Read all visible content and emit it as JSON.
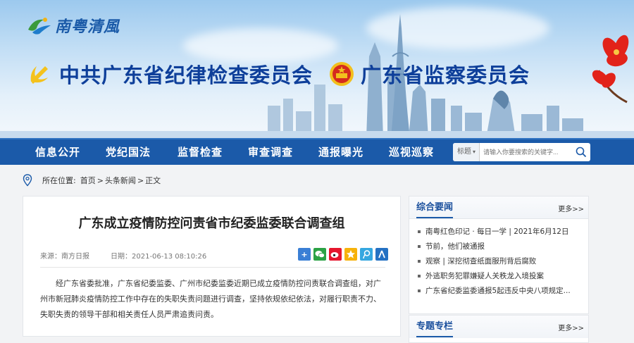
{
  "site": {
    "logo_text": "南粤清風",
    "org_party": "中共广东省纪律检查委员会",
    "org_supervision": "广东省监察委员会"
  },
  "nav": {
    "items": [
      "信息公开",
      "党纪国法",
      "监督检查",
      "审查调查",
      "通报曝光",
      "巡视巡察"
    ],
    "search_select": "标题",
    "search_placeholder": "请输入你要搜索的关键字...",
    "search_icon": "magnifier-icon"
  },
  "breadcrumb": {
    "label": "所在位置:",
    "items": [
      "首页",
      "头条新闻",
      "正文"
    ],
    "sep": " > "
  },
  "article": {
    "title": "广东成立疫情防控问责省市纪委监委联合调查组",
    "source": "来源：南方日报",
    "date": "日期：2021-06-13 08:10:26",
    "share_icons": [
      "plus-share-icon",
      "wechat-icon",
      "weibo-icon",
      "qzone-icon",
      "tencent-weibo-icon",
      "renren-icon"
    ],
    "body": "经广东省委批准，广东省纪委监委、广州市纪委监委近期已成立疫情防控问责联合调查组，对广州市新冠肺炎疫情防控工作中存在的失职失责问题进行调查，坚持依规依纪依法，对履行职责不力、失职失责的领导干部和相关责任人员严肃追责问责。"
  },
  "sidebar": {
    "section1_title": "综合要闻",
    "more": "更多>>",
    "news": [
      "南粤红色印记 · 每日一学 | 2021年6月12日",
      "节前，他们被通报",
      "观察 | 深挖彻查纸面服刑背后腐败",
      "外逃职务犯罪嫌疑人关秩龙入境投案",
      "广东省纪委监委通报5起违反中央八项规定..."
    ],
    "section2_title": "专题专栏",
    "more2": "更多>>"
  },
  "colors": {
    "nav_bg": "#1b5aa9",
    "title_blue": "#0e3f9a",
    "party_red": "#d52b1e"
  }
}
